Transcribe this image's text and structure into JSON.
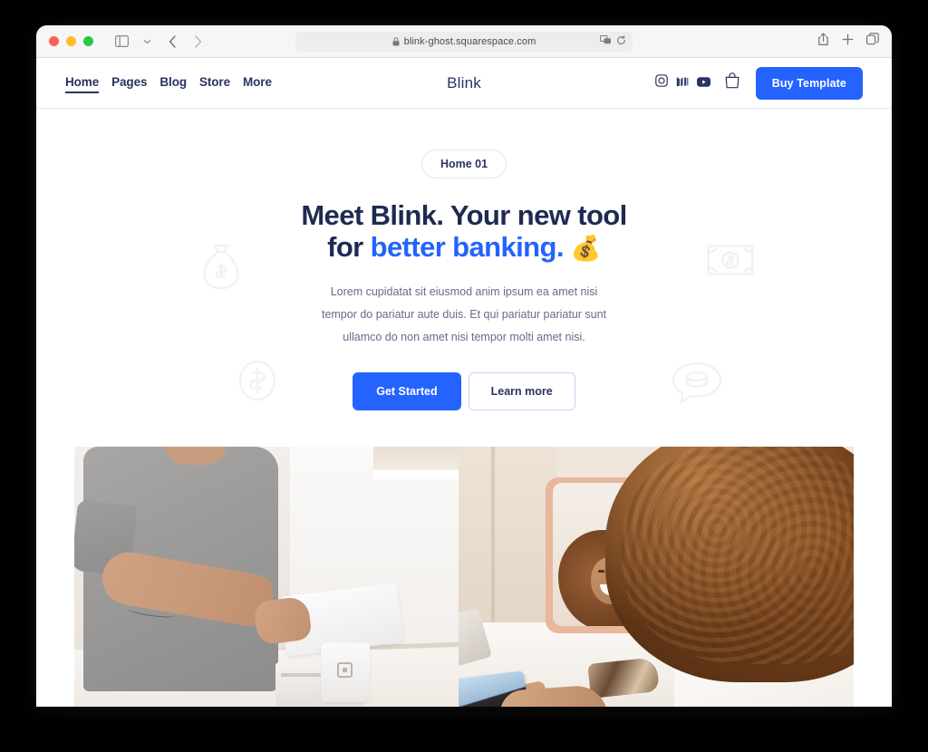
{
  "browser": {
    "traffic_lights": [
      "close",
      "minimize",
      "maximize"
    ],
    "sidebar_tooltip": "Sidebar",
    "back_label": "Back",
    "forward_label": "Forward",
    "url": "blink-ghost.squarespace.com",
    "lock_label": "Secure connection",
    "reader_label": "Reader",
    "reload_label": "Reload",
    "share_label": "Share",
    "new_tab_label": "New Tab",
    "tab_overview_label": "Tab Overview"
  },
  "site": {
    "logo": "Blink",
    "nav": [
      {
        "label": "Home",
        "active": true
      },
      {
        "label": "Pages",
        "active": false
      },
      {
        "label": "Blog",
        "active": false
      },
      {
        "label": "Store",
        "active": false
      },
      {
        "label": "More",
        "active": false
      }
    ],
    "social": [
      {
        "name": "instagram-icon",
        "label": "Instagram"
      },
      {
        "name": "medium-icon",
        "label": "Medium"
      },
      {
        "name": "youtube-icon",
        "label": "YouTube"
      }
    ],
    "cart_label": "Cart",
    "buy_button": "Buy Template"
  },
  "hero": {
    "badge": "Home 01",
    "headline_line1": "Meet Blink. Your new tool",
    "headline_line2_prefix": "for ",
    "headline_accent": "better banking.",
    "headline_emoji": "💰",
    "subtext_line1": "Lorem cupidatat sit eiusmod anim ipsum ea amet nisi",
    "subtext_line2": "tempor do pariatur aute duis. Et qui pariatur pariatur sunt",
    "subtext_line3": "ullamco do non amet nisi tempor molti amet nisi.",
    "primary_cta": "Get Started",
    "secondary_cta": "Learn more",
    "watermarks": [
      {
        "name": "money-bag-watermark"
      },
      {
        "name": "banknote-watermark"
      },
      {
        "name": "dollar-coin-watermark"
      },
      {
        "name": "money-chat-watermark"
      }
    ],
    "photo_alt": "Customer paying with phone at a white point-of-sale terminal"
  },
  "colors": {
    "accent_blue": "#2563ff",
    "navy": "#2b3360",
    "heading": "#1f2a52",
    "body_text": "#656b8c",
    "watermark": "#f4f4f6"
  }
}
